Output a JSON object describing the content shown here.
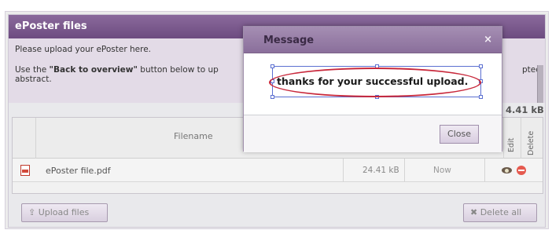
{
  "panel": {
    "title": "ePoster files",
    "info_line1": "Please upload your ePoster here.",
    "info_line2_prefix": "Use the ",
    "info_line2_bold": "\"Back to overview\"",
    "info_line2_suffix": " button below to up",
    "info_line2_wrap": "abstract.",
    "info_right": "pted",
    "total_size": "4.41 kB"
  },
  "table": {
    "headers": {
      "filename": "Filename",
      "edit": "Edit",
      "delete": "Delete"
    },
    "rows": [
      {
        "filename": "ePoster file.pdf",
        "size": "24.41 kB",
        "date": "Now",
        "icon": "pdf-icon"
      }
    ]
  },
  "buttons": {
    "upload": "⇪ Upload files",
    "delete_all": "✖ Delete all"
  },
  "modal": {
    "title": "Message",
    "close_x": "×",
    "message": "thanks for your successful upload.",
    "close_button": "Close"
  },
  "colors": {
    "header_purple": "#6d4c80",
    "modal_header": "#8a6f9b",
    "annotation_red": "#c8283b",
    "selection_blue": "#5b6fd1"
  }
}
